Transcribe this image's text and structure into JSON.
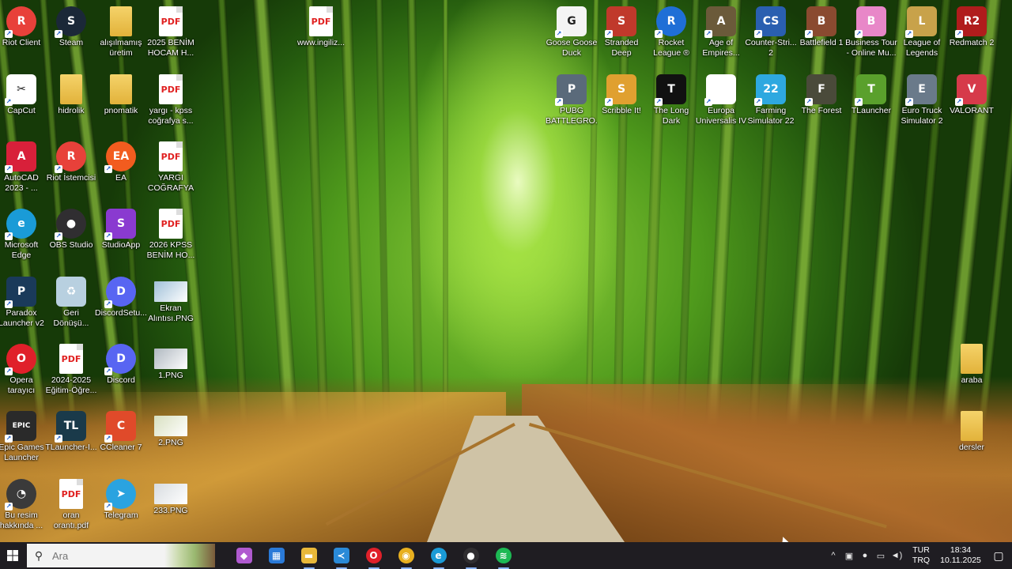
{
  "desktop": {
    "icons": [
      {
        "id": "riot-client",
        "label": "Riot Client",
        "glyph": "R",
        "color": "#e8413a"
      },
      {
        "id": "steam",
        "label": "Steam",
        "glyph": "S",
        "color": "#1b2838"
      },
      {
        "id": "alisilmamis-uretim",
        "label": "alışılmamış\nüretim",
        "glyph": "",
        "color": "#e8c24a"
      },
      {
        "id": "pdf-2025-benim-hocam",
        "label": "2025 BENİM\nHOCAM H...",
        "glyph": "PDF",
        "color": "#ffffff"
      },
      {
        "id": "pdf-www-ingiliz",
        "label": "www.ingiliz...",
        "glyph": "PDF",
        "color": "#ffffff"
      },
      {
        "id": "goose-goose-duck",
        "label": "Goose Goose\nDuck",
        "glyph": "G",
        "color": "#f4f4f4"
      },
      {
        "id": "stranded-deep",
        "label": "Stranded\nDeep",
        "glyph": "S",
        "color": "#c0392b"
      },
      {
        "id": "rocket-league",
        "label": "Rocket\nLeague ®",
        "glyph": "R",
        "color": "#1f6fd6"
      },
      {
        "id": "age-of-empires",
        "label": "Age of\nEmpires...",
        "glyph": "A",
        "color": "#6b5a3a"
      },
      {
        "id": "counter-strike-2",
        "label": "Counter-Stri...\n2",
        "glyph": "CS",
        "color": "#2a5fb0"
      },
      {
        "id": "battlefield-1",
        "label": "Battlefield 1",
        "glyph": "B",
        "color": "#8a4a30"
      },
      {
        "id": "business-tour",
        "label": "Business Tour\n- Online Mu...",
        "glyph": "B",
        "color": "#e887c8"
      },
      {
        "id": "league-of-legends",
        "label": "League of\nLegends",
        "glyph": "L",
        "color": "#c8a24a"
      },
      {
        "id": "redmatch-2",
        "label": "Redmatch 2",
        "glyph": "R2",
        "color": "#b01c1c"
      },
      {
        "id": "capcut",
        "label": "CapCut",
        "glyph": "✂",
        "color": "#ffffff"
      },
      {
        "id": "hidrolik",
        "label": "hidrolik",
        "glyph": "",
        "color": "#e8c24a"
      },
      {
        "id": "pnomatik",
        "label": "pnomatik",
        "glyph": "",
        "color": "#e8c24a"
      },
      {
        "id": "pdf-yargi-kpss",
        "label": "yargı - kpss\ncoğrafya s...",
        "glyph": "PDF",
        "color": "#ffffff"
      },
      {
        "id": "pubg",
        "label": "PUBG\nBATTLEGRO...",
        "glyph": "P",
        "color": "#5a6a7a"
      },
      {
        "id": "scribble-it",
        "label": "Scribble It!",
        "glyph": "S",
        "color": "#e0a030"
      },
      {
        "id": "the-long-dark",
        "label": "The Long\nDark",
        "glyph": "T",
        "color": "#111111"
      },
      {
        "id": "europa-universalis",
        "label": "Europa\nUniversalis IV",
        "glyph": "",
        "color": "#ffffff"
      },
      {
        "id": "farming-simulator-22",
        "label": "Farming\nSimulator 22",
        "glyph": "22",
        "color": "#2ea8e0"
      },
      {
        "id": "the-forest",
        "label": "The Forest",
        "glyph": "F",
        "color": "#4a4a3a"
      },
      {
        "id": "tlauncher-top",
        "label": "TLauncher",
        "glyph": "T",
        "color": "#5aa02c"
      },
      {
        "id": "euro-truck",
        "label": "Euro Truck\nSimulator 2",
        "glyph": "E",
        "color": "#6a7a8a"
      },
      {
        "id": "valorant",
        "label": "VALORANT",
        "glyph": "V",
        "color": "#d63a4a"
      },
      {
        "id": "autocad",
        "label": "AutoCAD\n2023 - ...",
        "glyph": "A",
        "color": "#d8203a"
      },
      {
        "id": "riot-istemcisi",
        "label": "Riot İstemcisi",
        "glyph": "R",
        "color": "#e8413a"
      },
      {
        "id": "ea",
        "label": "EA",
        "glyph": "EA",
        "color": "#f25c1f"
      },
      {
        "id": "pdf-yargi-cografya",
        "label": "YARGI\nCOĞRAFYA ...",
        "glyph": "PDF",
        "color": "#ffffff"
      },
      {
        "id": "microsoft-edge",
        "label": "Microsoft\nEdge",
        "glyph": "e",
        "color": "#1a9bd7"
      },
      {
        "id": "obs-studio",
        "label": "OBS Studio",
        "glyph": "●",
        "color": "#302e31"
      },
      {
        "id": "studioapp",
        "label": "StudioApp",
        "glyph": "S",
        "color": "#8a3ad0"
      },
      {
        "id": "pdf-2026-kpss",
        "label": "2026 KPSS\nBENİM HO...",
        "glyph": "PDF",
        "color": "#ffffff"
      },
      {
        "id": "paradox-launcher",
        "label": "Paradox\nLauncher v2",
        "glyph": "P",
        "color": "#1a3a5a"
      },
      {
        "id": "geri-donusum",
        "label": "Geri\nDönüşü...",
        "glyph": "♻",
        "color": "#b8d0e0"
      },
      {
        "id": "discord-setup",
        "label": "DiscordSetu...",
        "glyph": "D",
        "color": "#5865f2"
      },
      {
        "id": "ekran-alintisi",
        "label": "Ekran\nAlıntısı.PNG",
        "glyph": "",
        "color": "#a0c0d8"
      },
      {
        "id": "opera",
        "label": "Opera\ntarayıcı",
        "glyph": "O",
        "color": "#e0202a"
      },
      {
        "id": "pdf-2024-2025",
        "label": "2024-2025\nEğitim-Öğre...",
        "glyph": "PDF",
        "color": "#ffffff"
      },
      {
        "id": "discord",
        "label": "Discord",
        "glyph": "D",
        "color": "#5865f2"
      },
      {
        "id": "png-1",
        "label": "1.PNG",
        "glyph": "",
        "color": "#b0b8c0"
      },
      {
        "id": "epic-games",
        "label": "Epic Games\nLauncher",
        "glyph": "EPIC",
        "color": "#2a2a2a"
      },
      {
        "id": "tlauncher-desk",
        "label": "TLauncher-I...",
        "glyph": "TL",
        "color": "#1a3a4a"
      },
      {
        "id": "ccleaner",
        "label": "CCleaner 7",
        "glyph": "C",
        "color": "#e04a2a"
      },
      {
        "id": "png-2",
        "label": "2.PNG",
        "glyph": "",
        "color": "#d8e0c0"
      },
      {
        "id": "bu-resim-hakkinda",
        "label": "Bu resim\nhakkında ...",
        "glyph": "◔",
        "color": "#3a3a3a"
      },
      {
        "id": "pdf-oran-oranti",
        "label": "oran\norantı.pdf",
        "glyph": "PDF",
        "color": "#ffffff"
      },
      {
        "id": "telegram",
        "label": "Telegram",
        "glyph": "➤",
        "color": "#2aa3e0"
      },
      {
        "id": "png-233",
        "label": "233.PNG",
        "glyph": "",
        "color": "#d8dce0"
      },
      {
        "id": "araba",
        "label": "araba",
        "glyph": "",
        "color": "#e8c24a"
      },
      {
        "id": "dersler",
        "label": "dersler",
        "glyph": "",
        "color": "#e8c24a"
      }
    ]
  },
  "taskbar": {
    "search_placeholder": "Ara",
    "start_icon": "windows-logo",
    "apps": [
      {
        "id": "copilot",
        "icon": "copilot-icon",
        "glyph": "◆",
        "color": "#b05ad0"
      },
      {
        "id": "microsoft-store",
        "icon": "store-icon",
        "glyph": "▦",
        "color": "#2a7ad8"
      },
      {
        "id": "file-explorer",
        "icon": "folder-icon",
        "glyph": "▬",
        "color": "#e8b83a"
      },
      {
        "id": "vscode",
        "icon": "vscode-icon",
        "glyph": "≺",
        "color": "#2a8ad8"
      },
      {
        "id": "opera",
        "icon": "opera-icon",
        "glyph": "O",
        "color": "#e0202a"
      },
      {
        "id": "chrome",
        "icon": "chrome-icon",
        "glyph": "◉",
        "color": "#e8b020"
      },
      {
        "id": "edge",
        "icon": "edge-icon",
        "glyph": "e",
        "color": "#1a9bd7"
      },
      {
        "id": "obs",
        "icon": "obs-icon",
        "glyph": "●",
        "color": "#302e31"
      },
      {
        "id": "spotify",
        "icon": "spotify-icon",
        "glyph": "≋",
        "color": "#1db954"
      }
    ],
    "tray": {
      "lang_top": "TUR",
      "lang_bottom": "TRQ",
      "time": "18:34",
      "date": "10.11.2025"
    }
  }
}
